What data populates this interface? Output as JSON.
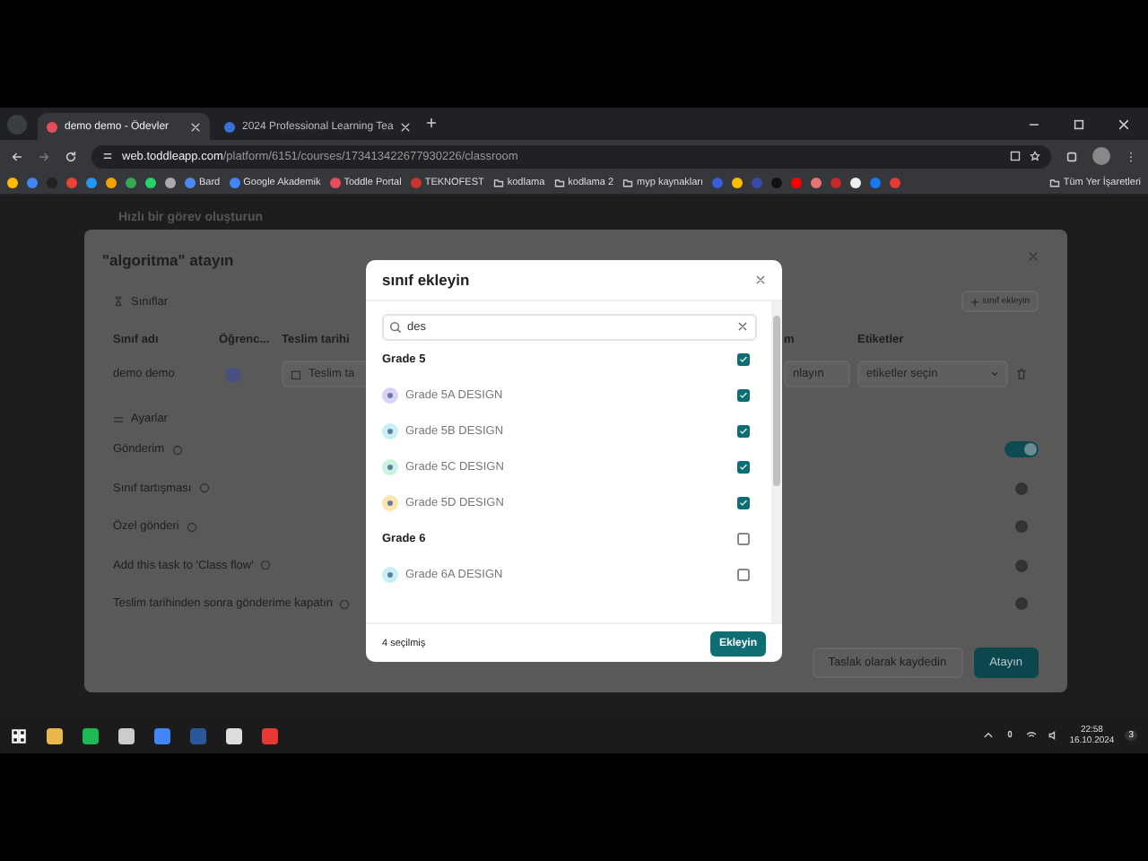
{
  "browser": {
    "tabs": [
      {
        "title": "demo demo - Ödevler",
        "selected": true
      },
      {
        "title": "2024 Professional Learning Tea",
        "selected": false
      }
    ],
    "url": {
      "host": "web.toddleapp.com",
      "path": "/platform/6151/courses/173413422677930226/classroom"
    },
    "bookmarks": [
      "Bard",
      "Google Akademik",
      "Toddle Portal",
      "TEKNOFEST",
      "kodlama",
      "kodlama 2",
      "myp kaynakları"
    ],
    "all_bookmarks": "Tüm Yer İşaretleri"
  },
  "page_header": "Hızlı bir görev oluşturun",
  "assign_dialog": {
    "title": "\"algoritma\" atayın",
    "classes_label": "Sınıflar",
    "add_class_button": "sınıf ekleyin",
    "columns": [
      "Sınıf adı",
      "Öğrenc...",
      "Teslim tarihi",
      "m",
      "Etiketler"
    ],
    "row": {
      "class_name": "demo demo",
      "due_date_placeholder": "Teslim ta",
      "field_4": "nlayın",
      "tags_placeholder": "etiketler seçin"
    },
    "settings_label": "Ayarlar",
    "settings": [
      {
        "label": "Gönderim",
        "on": true
      },
      {
        "label": "Sınıf tartışması",
        "on": false
      },
      {
        "label": "Özel gönderi",
        "on": false
      },
      {
        "label": "Add this task to 'Class flow'",
        "on": false
      },
      {
        "label": "Teslim tarihinden sonra gönderime kapatın",
        "on": false
      }
    ],
    "buttons": [
      "Taslak olarak kaydedin",
      "Atayın"
    ]
  },
  "class_picker": {
    "title": "sınıf ekleyin",
    "search": {
      "value": "des"
    },
    "groups": [
      {
        "name": "Grade 5",
        "checked": true,
        "classes": [
          {
            "name": "Grade 5A DESIGN",
            "checked": true,
            "color": "#d9d3f7"
          },
          {
            "name": "Grade 5B DESIGN",
            "checked": true,
            "color": "#c6eff6"
          },
          {
            "name": "Grade 5C DESIGN",
            "checked": true,
            "color": "#c8f3df"
          },
          {
            "name": "Grade 5D DESIGN",
            "checked": true,
            "color": "#fbe7ae"
          }
        ]
      },
      {
        "name": "Grade 6",
        "checked": false,
        "classes": [
          {
            "name": "Grade 6A DESIGN",
            "checked": false,
            "color": "#c6eff6"
          }
        ]
      }
    ],
    "selected_count": "4 seçilmiş",
    "add_button": "Ekleyin"
  },
  "taskbar": {
    "time": "22:58",
    "date": "16.10.2024",
    "notifications": "3"
  }
}
